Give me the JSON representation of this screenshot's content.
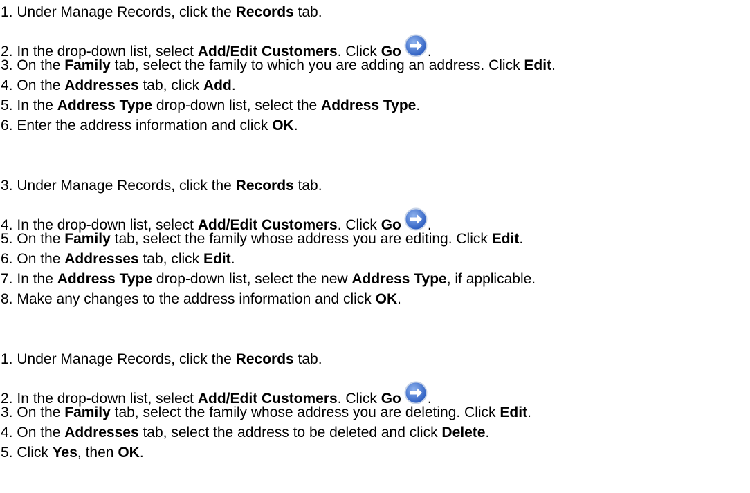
{
  "sections": [
    {
      "steps": [
        {
          "num": "1.",
          "parts": [
            "Under Manage Records, click the ",
            "Records",
            " tab."
          ]
        },
        {
          "num": "2.",
          "parts": [
            "In the drop-down list, select ",
            "Add/Edit Customers",
            ". Click ",
            "Go",
            "."
          ]
        },
        {
          "num": "3.",
          "parts": [
            "On the ",
            "Family",
            " tab, select the family to which you are adding an address. Click ",
            "Edit",
            "."
          ]
        },
        {
          "num": "4.",
          "parts": [
            "On the ",
            "Addresses",
            " tab, click ",
            "Add",
            "."
          ]
        },
        {
          "num": "5.",
          "parts": [
            "In the ",
            "Address Type",
            " drop-down list, select the ",
            "Address Type",
            "."
          ]
        },
        {
          "num": "6.",
          "parts": [
            "Enter the address information and click ",
            "OK",
            "."
          ]
        }
      ]
    },
    {
      "steps": [
        {
          "num": "3.",
          "parts": [
            "Under Manage Records, click the ",
            "Records",
            " tab."
          ]
        },
        {
          "num": "4.",
          "parts": [
            "In the drop-down list, select ",
            "Add/Edit Customers",
            ". Click ",
            "Go",
            "."
          ]
        },
        {
          "num": "5.",
          "parts": [
            "On the ",
            "Family",
            " tab, select the family whose address you are editing. Click ",
            "Edit",
            "."
          ]
        },
        {
          "num": "6.",
          "parts": [
            "On the ",
            "Addresses",
            " tab, click ",
            "Edit",
            "."
          ]
        },
        {
          "num": "7.",
          "parts": [
            "In the ",
            "Address Type",
            " drop-down list, select the new ",
            "Address Type",
            ", if applicable."
          ]
        },
        {
          "num": "8.",
          "parts": [
            "Make any changes to the address information and click ",
            "OK",
            "."
          ]
        }
      ]
    },
    {
      "steps": [
        {
          "num": "1.",
          "parts": [
            "Under Manage Records, click the ",
            "Records",
            " tab."
          ]
        },
        {
          "num": "2.",
          "parts": [
            "In the drop-down list, select ",
            "Add/Edit Customers",
            ". Click ",
            "Go",
            "."
          ]
        },
        {
          "num": "3.",
          "parts": [
            "On the ",
            "Family",
            " tab, select the family whose address you are deleting. Click ",
            "Edit",
            "."
          ]
        },
        {
          "num": "4.",
          "parts": [
            "On the ",
            "Addresses",
            " tab, select the address to be deleted and click ",
            "Delete",
            "."
          ]
        },
        {
          "num": "5.",
          "parts": [
            "Click ",
            "Yes",
            ", then ",
            "OK",
            "."
          ]
        }
      ]
    }
  ],
  "icons": {
    "go_button_icon": "go-arrow-icon",
    "go_icon_color": "#3a6fd0"
  }
}
